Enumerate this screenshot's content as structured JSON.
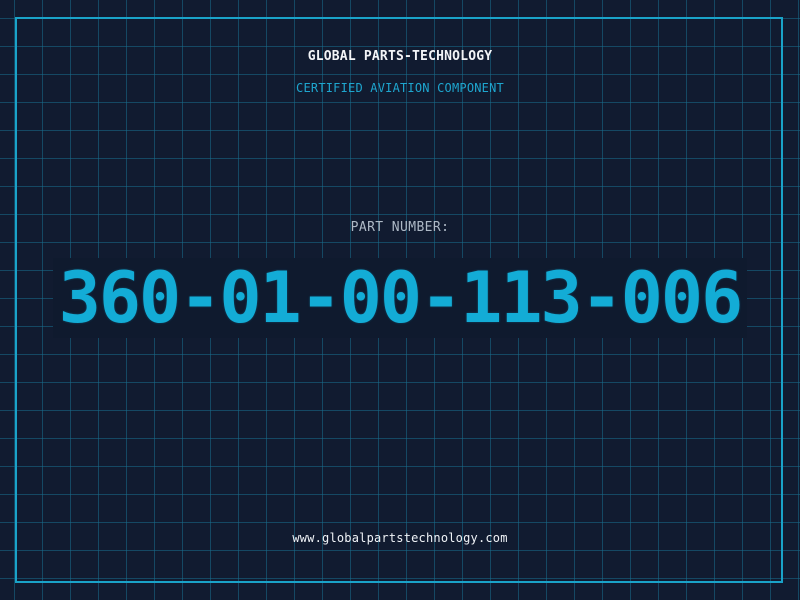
{
  "header": {
    "company": "GLOBAL PARTS-TECHNOLOGY",
    "tagline": "CERTIFIED AVIATION COMPONENT"
  },
  "part": {
    "label": "PART NUMBER:",
    "number": "360-01-00-113-006"
  },
  "footer": {
    "website": "www.globalpartstechnology.com"
  },
  "colors": {
    "background": "#111b30",
    "grid": "#186e8c",
    "accent": "#13acd6",
    "text": "#f2f4f7",
    "muted": "#aeb9c6"
  }
}
